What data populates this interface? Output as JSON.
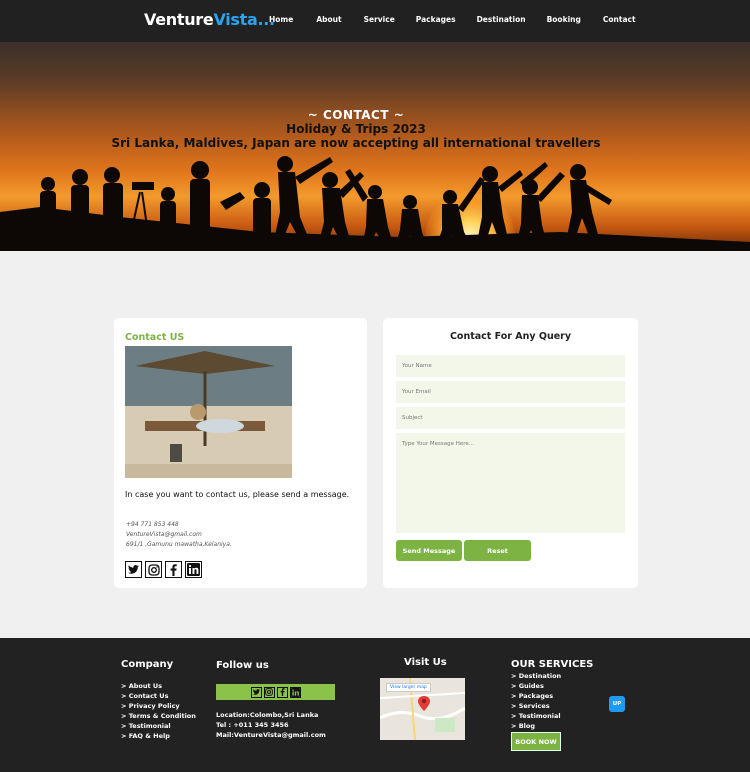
{
  "nav": {
    "logo_main": "Venture",
    "logo_accent": "Vista...",
    "links": [
      "Home",
      "About",
      "Service",
      "Packages",
      "Destination",
      "Booking",
      "Contact"
    ]
  },
  "hero": {
    "title": "~ CONTACT ~",
    "subtitle1": "Holiday & Trips 2023",
    "subtitle2": "Sri Lanka, Maldives, Japan are now accepting all international travellers"
  },
  "contact": {
    "heading": "Contact US",
    "message": "In case you want to contact us, please send a message.",
    "phone": "+94 771 853 448",
    "email": "VentureVista@gmail.com",
    "address": "691/1 ,Gamunu mawatha,Kelaniya."
  },
  "query": {
    "title": "Contact For Any Query",
    "name_placeholder": "Your Name",
    "email_placeholder": "Your Email",
    "subject_placeholder": "Subject",
    "message_placeholder": "Type Your Message Here...",
    "send_label": "Send Message",
    "reset_label": "Reset"
  },
  "footer": {
    "company_heading": "Company",
    "company_links": [
      "> About Us",
      "> Contact Us",
      "> Privacy Policy",
      "> Terms & Condition",
      "> Testimonial",
      "> FAQ & Help"
    ],
    "follow_heading": "Follow us",
    "location": "Location:Colombo,Sri Lanka",
    "tel": "Tel : +011 345 3456",
    "mail": "Mail:VentureVista@gmail.com",
    "visit_heading": "Visit Us",
    "map_link": "View larger map",
    "services_heading": "OUR SERVICES",
    "services_links": [
      "> Destination",
      "> Guides",
      "> Packages",
      "> Services",
      "> Testimonial",
      "> Blog"
    ],
    "book_label": "BOOK NOW",
    "up_label": "UP"
  },
  "colors": {
    "accent_green": "#7cb342",
    "accent_blue": "#2aa3f0",
    "dark": "#212121"
  }
}
